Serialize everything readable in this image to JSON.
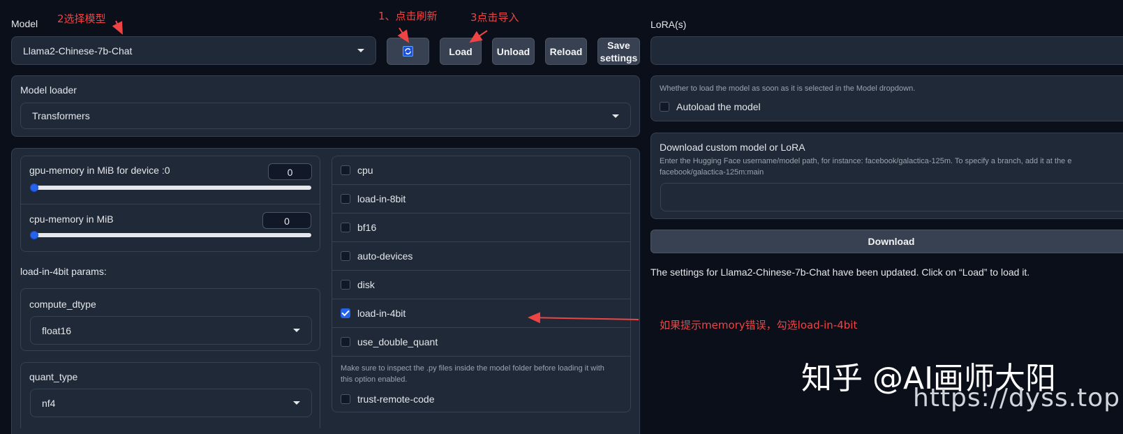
{
  "model": {
    "label": "Model",
    "selected": "Llama2-Chinese-7b-Chat",
    "refresh_icon": "refresh-icon",
    "load_label": "Load",
    "unload_label": "Unload",
    "reload_label": "Reload",
    "save_label_line1": "Save",
    "save_label_line2": "settings"
  },
  "loader": {
    "label": "Model loader",
    "selected": "Transformers"
  },
  "memory": {
    "gpu_label": "gpu-memory in MiB for device :0",
    "gpu_value": "0",
    "gpu_level": 0,
    "cpu_label": "cpu-memory in MiB",
    "cpu_value": "0",
    "cpu_level": 0
  },
  "params_4bit": {
    "heading": "load-in-4bit params:",
    "compute_dtype_label": "compute_dtype",
    "compute_dtype_value": "float16",
    "quant_type_label": "quant_type",
    "quant_type_value": "nf4"
  },
  "checkboxes": [
    {
      "label": "cpu",
      "checked": false
    },
    {
      "label": "load-in-8bit",
      "checked": false
    },
    {
      "label": "bf16",
      "checked": false
    },
    {
      "label": "auto-devices",
      "checked": false
    },
    {
      "label": "disk",
      "checked": false
    },
    {
      "label": "load-in-4bit",
      "checked": true
    },
    {
      "label": "use_double_quant",
      "checked": false
    }
  ],
  "trust": {
    "note_line1": "Make sure to inspect the .py files inside the model folder before loading it with",
    "note_line2": "this option enabled.",
    "label": "trust-remote-code"
  },
  "lora": {
    "label": "LoRA(s)"
  },
  "autoload": {
    "info": "Whether to load the model as soon as it is selected in the Model dropdown.",
    "label": "Autoload the model"
  },
  "download": {
    "title": "Download custom model or LoRA",
    "info_line1": "Enter the Hugging Face username/model path, for instance: facebook/galactica-125m. To specify a branch, add it at the e",
    "info_line2": "facebook/galactica-125m:main",
    "button_label": "Download"
  },
  "status": "The settings for Llama2-Chinese-7b-Chat have been updated. Click on “Load” to load it.",
  "annotations": {
    "select_model": "2选择模型",
    "refresh": "1、点击刷新",
    "load": "3点击导入",
    "memory_tip": "如果提示memory错误，勾选load-in-4bit"
  },
  "watermark": {
    "text": "知乎 @AI画师大阳",
    "url": "https://dyss.top"
  },
  "colors": {
    "background": "#0b0f19",
    "panel": "#1f2937",
    "accent": "#2563eb",
    "annotation": "#ef4444"
  }
}
